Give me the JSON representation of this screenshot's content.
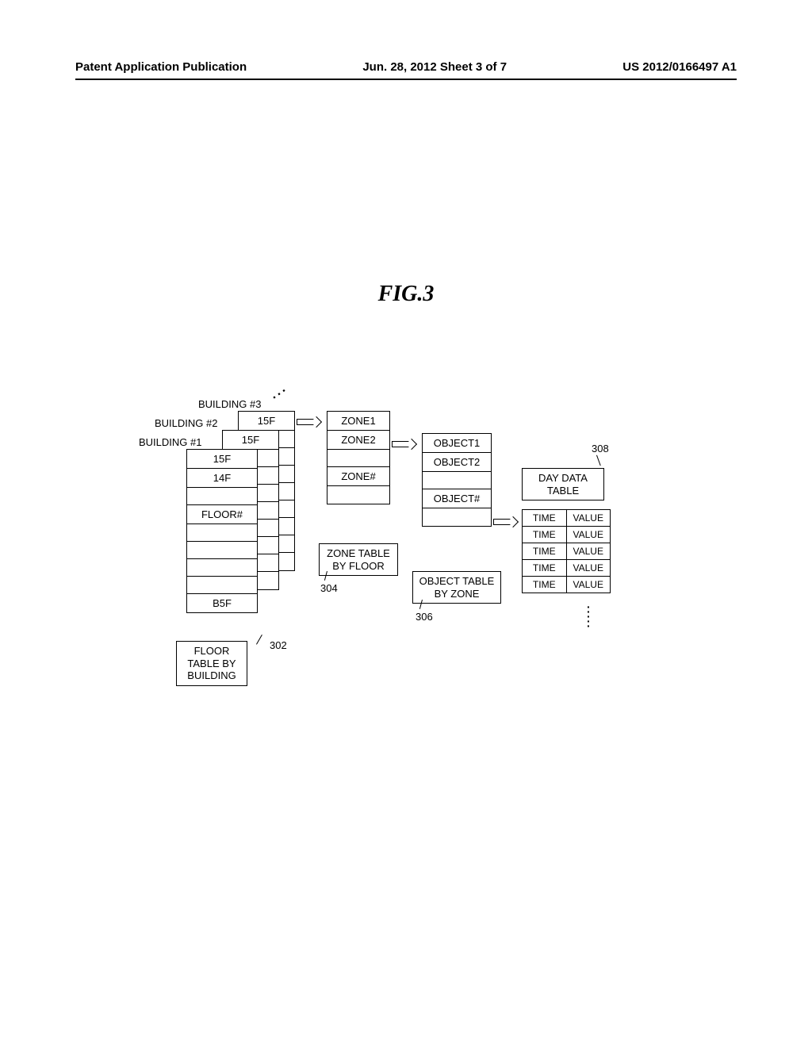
{
  "header": {
    "left": "Patent Application Publication",
    "center": "Jun. 28, 2012  Sheet 3 of 7",
    "right": "US 2012/0166497 A1"
  },
  "figure_title": "FIG.3",
  "labels": {
    "b1": "BUILDING #1",
    "b2": "BUILDING #2",
    "b3": "BUILDING #3"
  },
  "floor_table": {
    "caption": "FLOOR TABLE BY BUILDING",
    "rows": [
      "15F",
      "14F",
      "",
      "FLOOR#",
      "",
      "",
      "",
      "",
      "B5F"
    ],
    "ref": "302"
  },
  "stack2_top": "15F",
  "stack3_top": "15F",
  "zone_table": {
    "caption": "ZONE TABLE BY FLOOR",
    "rows": [
      "ZONE1",
      "ZONE2",
      "",
      "ZONE#",
      ""
    ],
    "ref": "304"
  },
  "object_table": {
    "caption": "OBJECT TABLE BY ZONE",
    "rows": [
      "OBJECT1",
      "OBJECT2",
      "",
      "OBJECT#",
      ""
    ],
    "ref": "306"
  },
  "day_table": {
    "caption": "DAY DATA TABLE",
    "ref": "308",
    "rows": [
      {
        "c1": "TIME",
        "c2": "VALUE"
      },
      {
        "c1": "TIME",
        "c2": "VALUE"
      },
      {
        "c1": "TIME",
        "c2": "VALUE"
      },
      {
        "c1": "TIME",
        "c2": "VALUE"
      },
      {
        "c1": "TIME",
        "c2": "VALUE"
      }
    ]
  },
  "chart_data": {
    "type": "table",
    "title": "Hierarchical data-table relationship",
    "hierarchy": [
      {
        "level": "BUILDING",
        "table": "FLOOR TABLE BY BUILDING",
        "ref": 302,
        "sample_rows": [
          "15F",
          "14F",
          "FLOOR#",
          "B5F"
        ]
      },
      {
        "level": "FLOOR",
        "table": "ZONE TABLE BY FLOOR",
        "ref": 304,
        "sample_rows": [
          "ZONE1",
          "ZONE2",
          "ZONE#"
        ]
      },
      {
        "level": "ZONE",
        "table": "OBJECT TABLE BY ZONE",
        "ref": 306,
        "sample_rows": [
          "OBJECT1",
          "OBJECT2",
          "OBJECT#"
        ]
      },
      {
        "level": "OBJECT",
        "table": "DAY DATA TABLE",
        "ref": 308,
        "columns": [
          "TIME",
          "VALUE"
        ]
      }
    ]
  }
}
